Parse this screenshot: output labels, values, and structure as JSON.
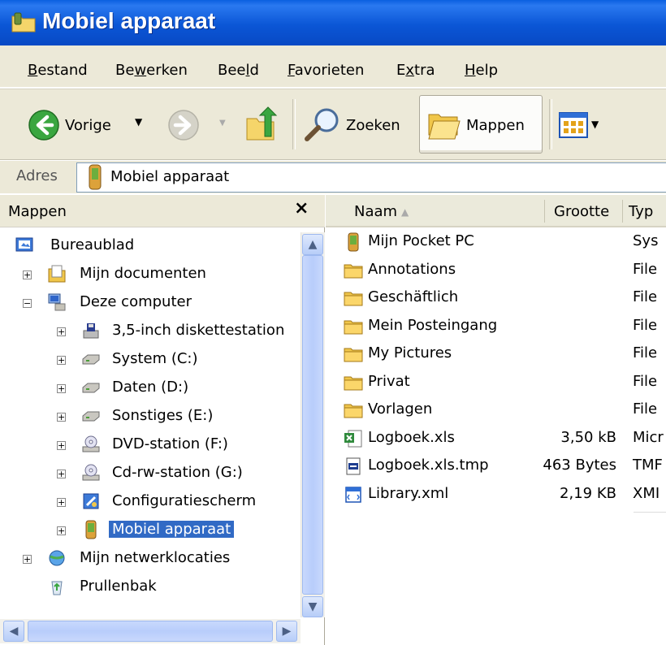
{
  "window": {
    "title": "Mobiel apparaat"
  },
  "menu": [
    {
      "label": "Bestand",
      "key": "B"
    },
    {
      "label": "Bewerken",
      "key": "w"
    },
    {
      "label": "Beeld",
      "key": "l"
    },
    {
      "label": "Favorieten",
      "key": "F"
    },
    {
      "label": "Extra",
      "key": "x"
    },
    {
      "label": "Help",
      "key": "H"
    }
  ],
  "toolbar": {
    "back_label": "Vorige",
    "search_label": "Zoeken",
    "folders_label": "Mappen"
  },
  "address": {
    "label": "Adres",
    "value": "Mobiel apparaat"
  },
  "folders_pane": {
    "title": "Mappen",
    "close": "×",
    "tree": [
      {
        "label": "Bureaublad",
        "icon": "desktop-icon",
        "expander": ""
      },
      {
        "label": "Mijn documenten",
        "icon": "my-documents-icon",
        "expander": "+"
      },
      {
        "label": "Deze computer",
        "icon": "my-computer-icon",
        "expander": "−"
      },
      {
        "label": "3,5-inch diskettestation",
        "icon": "floppy-drive-icon",
        "expander": "+"
      },
      {
        "label": "System (C:)",
        "icon": "hard-drive-icon",
        "expander": "+"
      },
      {
        "label": "Daten (D:)",
        "icon": "hard-drive-icon",
        "expander": "+"
      },
      {
        "label": "Sonstiges (E:)",
        "icon": "hard-drive-icon",
        "expander": "+"
      },
      {
        "label": "DVD-station (F:)",
        "icon": "dvd-drive-icon",
        "expander": "+"
      },
      {
        "label": "Cd-rw-station (G:)",
        "icon": "cd-drive-icon",
        "expander": "+"
      },
      {
        "label": "Configuratiescherm",
        "icon": "control-panel-icon",
        "expander": "+"
      },
      {
        "label": "Mobiel apparaat",
        "icon": "mobile-device-icon",
        "expander": "+",
        "selected": true
      },
      {
        "label": "Mijn netwerklocaties",
        "icon": "network-places-icon",
        "expander": "+"
      },
      {
        "label": "Prullenbak",
        "icon": "recycle-bin-icon",
        "expander": ""
      }
    ]
  },
  "file_list": {
    "columns": [
      "Naam",
      "Grootte",
      "Typ"
    ],
    "rows": [
      {
        "name": "Mijn Pocket PC",
        "size": "",
        "type": "Sys",
        "icon": "pocket-pc-icon"
      },
      {
        "name": "Annotations",
        "size": "",
        "type": "File",
        "icon": "folder-icon"
      },
      {
        "name": "Geschäftlich",
        "size": "",
        "type": "File",
        "icon": "folder-icon"
      },
      {
        "name": "Mein Posteingang",
        "size": "",
        "type": "File",
        "icon": "folder-icon"
      },
      {
        "name": "My Pictures",
        "size": "",
        "type": "File",
        "icon": "folder-icon"
      },
      {
        "name": "Privat",
        "size": "",
        "type": "File",
        "icon": "folder-icon"
      },
      {
        "name": "Vorlagen",
        "size": "",
        "type": "File",
        "icon": "folder-icon"
      },
      {
        "name": "Logboek.xls",
        "size": "3,50 kB",
        "type": "Micr",
        "icon": "excel-file-icon"
      },
      {
        "name": "Logboek.xls.tmp",
        "size": "463 Bytes",
        "type": "TMF",
        "icon": "tmp-file-icon"
      },
      {
        "name": "Library.xml",
        "size": "2,19 KB",
        "type": "XMI",
        "icon": "xml-file-icon"
      }
    ]
  },
  "colors": {
    "titlebar": "#0b56d6",
    "selection": "#316ac5",
    "chrome": "#ece9d8"
  }
}
